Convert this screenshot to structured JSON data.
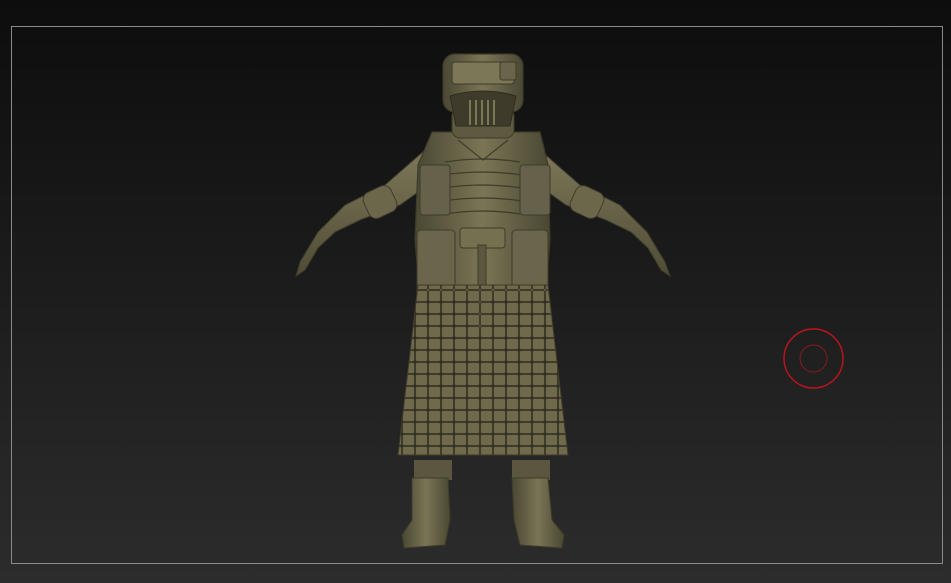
{
  "viewport": {
    "background_top": "#0d0d0d",
    "background_bottom": "#2c2c2c",
    "frame_color": "#8a8a8a"
  },
  "model": {
    "material_color": "#6e6a4e",
    "shadow_color": "#3d3a28",
    "highlight_color": "#8f8a66"
  },
  "brush_cursor": {
    "color": "#c0141c"
  }
}
